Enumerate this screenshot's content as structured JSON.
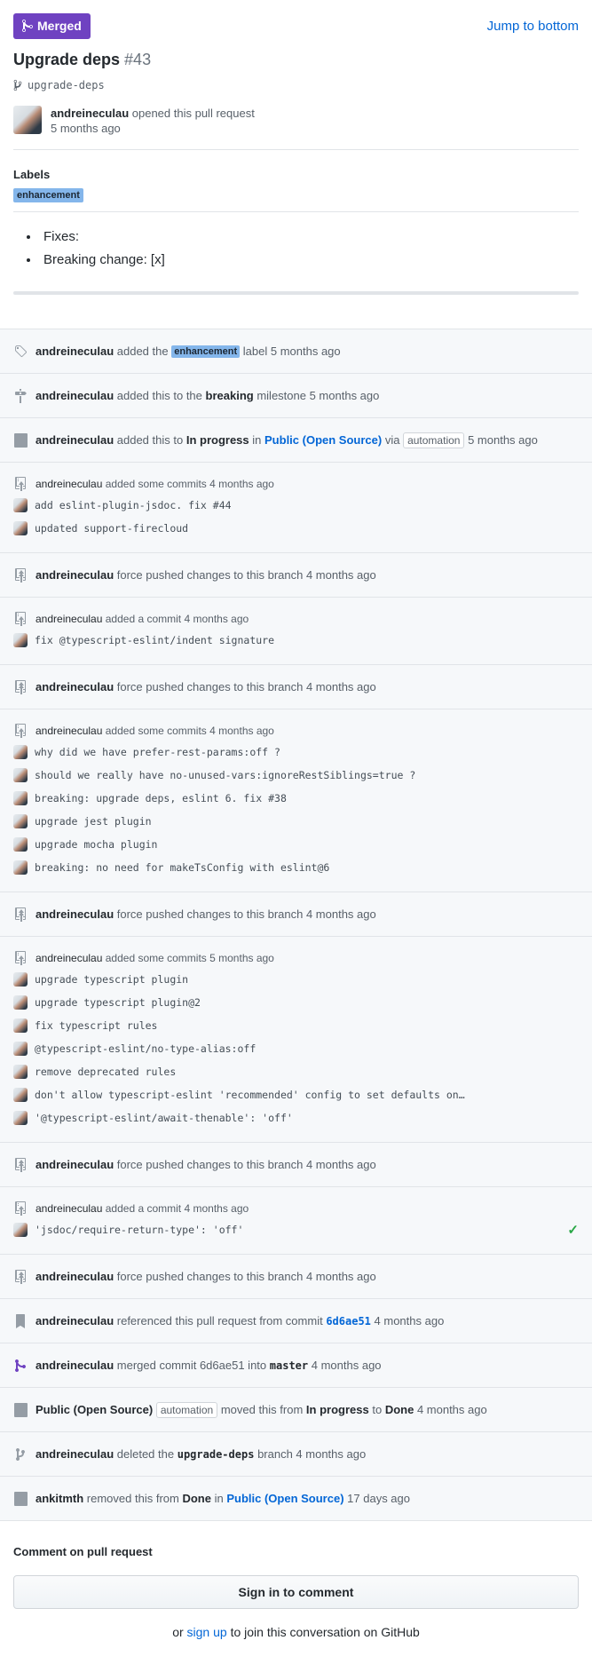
{
  "header": {
    "state_label": "Merged",
    "jump_label": "Jump to bottom",
    "title": "Upgrade deps",
    "number": "#43",
    "branch": "upgrade-deps"
  },
  "opener": {
    "author": "andreineculau",
    "action": "opened this pull request",
    "time": "5 months ago"
  },
  "labels": {
    "heading": "Labels",
    "items": [
      "enhancement"
    ]
  },
  "body": {
    "items": [
      "Fixes:",
      "Breaking change: [x]"
    ]
  },
  "timeline": {
    "e1": {
      "actor": "andreineculau",
      "pre": "added the",
      "label": "enhancement",
      "post": "label 5 months ago"
    },
    "e2": {
      "actor": "andreineculau",
      "pre": "added this to the",
      "milestone": "breaking",
      "post": "milestone 5 months ago"
    },
    "e3": {
      "actor": "andreineculau",
      "pre": "added this to",
      "column": "In progress",
      "mid": "in",
      "project": "Public (Open Source)",
      "via": "via",
      "app": "automation",
      "time": "5 months ago"
    },
    "c1": {
      "actor": "andreineculau",
      "text": "added some commits 4 months ago",
      "commits": [
        "add eslint-plugin-jsdoc. fix #44",
        "updated support-firecloud"
      ]
    },
    "f1": {
      "actor": "andreineculau",
      "text": "force pushed changes to this branch 4 months ago"
    },
    "c2": {
      "actor": "andreineculau",
      "text": "added a commit 4 months ago",
      "commits": [
        "fix @typescript-eslint/indent signature"
      ]
    },
    "f2": {
      "actor": "andreineculau",
      "text": "force pushed changes to this branch 4 months ago"
    },
    "c3": {
      "actor": "andreineculau",
      "text": "added some commits 4 months ago",
      "commits": [
        "why did we have prefer-rest-params:off ?",
        "should we really have no-unused-vars:ignoreRestSiblings=true ?",
        "breaking: upgrade deps, eslint 6. fix #38",
        "upgrade jest plugin",
        "upgrade mocha plugin",
        "breaking: no need for makeTsConfig with eslint@6"
      ]
    },
    "f3": {
      "actor": "andreineculau",
      "text": "force pushed changes to this branch 4 months ago"
    },
    "c4": {
      "actor": "andreineculau",
      "text": "added some commits 5 months ago",
      "commits": [
        "upgrade typescript plugin",
        "upgrade typescript plugin@2",
        "fix typescript rules",
        "@typescript-eslint/no-type-alias:off",
        "remove deprecated rules",
        "don't allow typescript-eslint 'recommended' config to set defaults on…",
        "'@typescript-eslint/await-thenable': 'off'"
      ]
    },
    "f4": {
      "actor": "andreineculau",
      "text": "force pushed changes to this branch 4 months ago"
    },
    "c5": {
      "actor": "andreineculau",
      "text": "added a commit 4 months ago",
      "commits": [
        "'jsdoc/require-return-type': 'off'"
      ]
    },
    "f5": {
      "actor": "andreineculau",
      "text": "force pushed changes to this branch 4 months ago"
    },
    "ref": {
      "actor": "andreineculau",
      "pre": "referenced this pull request from commit",
      "sha": "6d6ae51",
      "post": "4 months ago"
    },
    "merge": {
      "actor": "andreineculau",
      "pre": "merged commit 6d6ae51 into",
      "branch": "master",
      "post": "4 months ago"
    },
    "move": {
      "project": "Public (Open Source)",
      "app": "automation",
      "pre": "moved this from",
      "from": "In progress",
      "mid": "to",
      "to": "Done",
      "post": "4 months ago"
    },
    "del": {
      "actor": "andreineculau",
      "pre": "deleted the",
      "branch": "upgrade-deps",
      "post": "branch 4 months ago"
    },
    "rem": {
      "actor": "ankitmth",
      "pre": "removed this from",
      "column": "Done",
      "mid": "in",
      "project": "Public (Open Source)",
      "post": "17 days ago"
    }
  },
  "comment": {
    "heading": "Comment on pull request",
    "button": "Sign in to comment",
    "join_pre": "or",
    "join_link": "sign up",
    "join_post": "to join this conversation on GitHub"
  },
  "colors": {
    "merged": "#6f42c1",
    "link": "#0366d6",
    "label_enhancement": "#84b6eb",
    "success": "#28a745"
  }
}
